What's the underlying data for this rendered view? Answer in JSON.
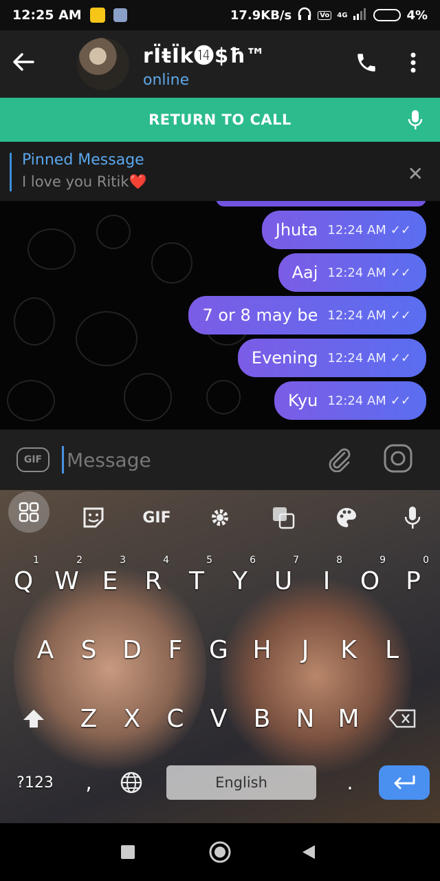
{
  "status_bar": {
    "time": "12:25 AM",
    "network_speed": "17.9KB/s",
    "network_type": "4G",
    "battery": "4%"
  },
  "header": {
    "title": "rÏŧÏk⓮$ħ™",
    "subtitle": "online"
  },
  "call_bar": {
    "label": "RETURN TO CALL"
  },
  "pinned": {
    "label": "Pinned Message",
    "text": "I love you Ritik❤️"
  },
  "messages": [
    {
      "text": "Jhuta",
      "time": "12:24 AM"
    },
    {
      "text": "Aaj",
      "time": "12:24 AM"
    },
    {
      "text": "7 or 8 may be",
      "time": "12:24 AM"
    },
    {
      "text": "Evening",
      "time": "12:24 AM"
    },
    {
      "text": "Kyu",
      "time": "12:24 AM"
    }
  ],
  "input": {
    "gif_label": "GIF",
    "placeholder": "Message"
  },
  "keyboard": {
    "toolbar_gif": "GIF",
    "row1": [
      "Q",
      "W",
      "E",
      "R",
      "T",
      "Y",
      "U",
      "I",
      "O",
      "P"
    ],
    "row1_numbers": [
      "1",
      "2",
      "3",
      "4",
      "5",
      "6",
      "7",
      "8",
      "9",
      "0"
    ],
    "row2": [
      "A",
      "S",
      "D",
      "F",
      "G",
      "H",
      "J",
      "K",
      "L"
    ],
    "row3": [
      "Z",
      "X",
      "C",
      "V",
      "B",
      "N",
      "M"
    ],
    "symbols_key": "?123",
    "comma_key": ",",
    "period_key": ".",
    "space_label": "English",
    "accent_color": "#4a90f0"
  },
  "colors": {
    "call_bar": "#2cbb8d",
    "bubble": "#6a5ae8",
    "link": "#5ba7ee"
  }
}
